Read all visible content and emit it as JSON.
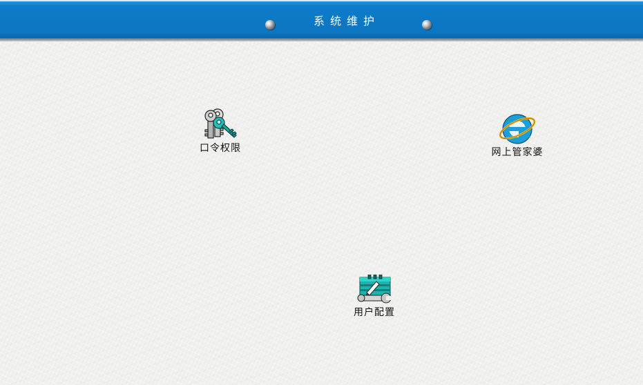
{
  "header": {
    "title": "系统维护"
  },
  "icons": [
    {
      "label": "口令权限",
      "icon": "keys-icon"
    },
    {
      "label": "网上管家婆",
      "icon": "internet-explorer-icon"
    },
    {
      "label": "用户配置",
      "icon": "wrench-gear-icon"
    }
  ],
  "colors": {
    "header_blue": "#0b76c2",
    "icon_teal": "#1bb5b0",
    "background": "#f1f1ef"
  }
}
